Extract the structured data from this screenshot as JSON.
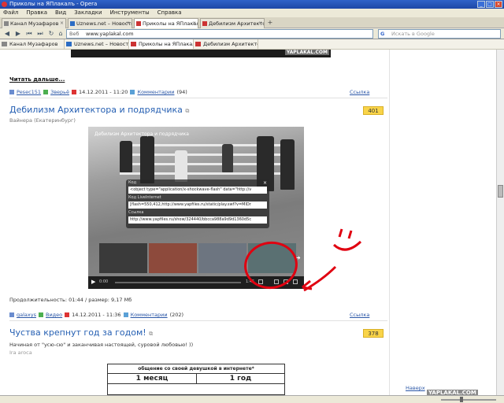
{
  "window": {
    "title": "Приколы на ЯПлакалъ - Opera",
    "controls": [
      "_",
      "□",
      "×"
    ]
  },
  "menu": [
    "Файл",
    "Правка",
    "Вид",
    "Закладки",
    "Инструменты",
    "Справка"
  ],
  "tabs": [
    {
      "label": "Канал Музафаров"
    },
    {
      "label": "Uznews.net – Новости ..."
    },
    {
      "label": "Приколы на ЯПлакалъ",
      "active": true
    },
    {
      "label": "Дебилизм Архитектора ..."
    }
  ],
  "address": {
    "prefix": "Веб",
    "url": "www.yaplakal.com",
    "search_placeholder": "Искать в Google"
  },
  "bookmarks": [
    {
      "label": "Канал Музафаров"
    },
    {
      "label": "Uznews.net – Новости ..."
    },
    {
      "label": "Приколы на ЯПлакалъ",
      "active": true
    },
    {
      "label": "Дебилизм Архитектора ..."
    }
  ],
  "top_watermark": "YAPLAKAL.COM",
  "read_more": "Читать дальше...",
  "post1_meta": {
    "author": "Pesec151",
    "category": "Зверьё",
    "date": "14.12.2011 - 11:20",
    "comments": "Комментарии",
    "comments_count": "(94)",
    "link": "Ссылка"
  },
  "post2": {
    "title": "Дебилизм Архитектора и подрядчика",
    "subtitle": "Вайнера (Екатеринбург)",
    "rating": "401",
    "video_title": "Дебилизм Архитектора и подрядчика",
    "embed_label_code": "Код",
    "embed_code": "<object type=\"application/x-shockwave-flash\" data=\"http://v",
    "embed_label_live": "Код LiveInternet",
    "embed_live": "[flash=550,412,http://www.yapfiles.ru/static/play.swf?v=MlDr",
    "embed_label_link": "Ссылка",
    "embed_link": "http://www.yapfiles.ru/show/324440/bbcca988a9d9d1360d5c",
    "time_left": "0:00",
    "time_right": "1:45",
    "duration": "Продолжительность: 01:44 / размер: 9,17 Мб",
    "meta": {
      "author": "galaxys",
      "category": "Видео",
      "date": "14.12.2011 - 11:36",
      "comments": "Комментарии",
      "comments_count": "(202)",
      "link": "Ссылка"
    }
  },
  "post3": {
    "title": "Чуства крепнут год за годом!",
    "rating": "378",
    "desc": "Начиная от \"усю-сю\" и заканчивая настоящей, суровой любовью! ))",
    "author": "Ira aroca",
    "table_header": "общение со своей девушкой в интернете*",
    "col1": "1 месяц",
    "col2": "1 год"
  },
  "nav_up": "Наверх",
  "bottom_watermark": "YAPLAKAL.COM",
  "colors": {
    "link": "#2660b3",
    "rating_bg": "#f9d449",
    "annotation": "#e00010"
  }
}
